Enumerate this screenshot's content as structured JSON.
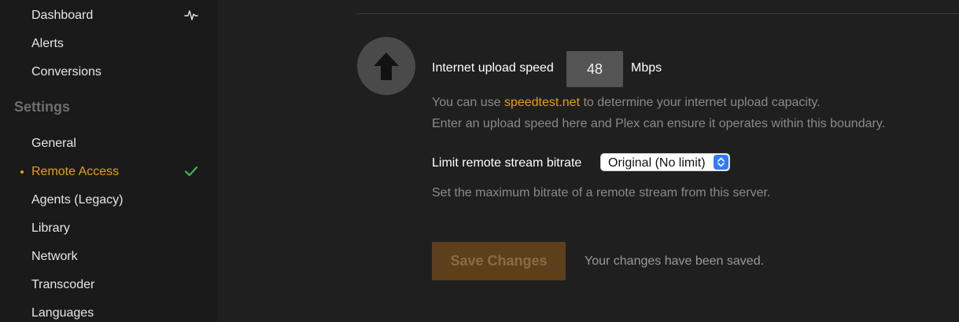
{
  "sidebar": {
    "items_top": [
      {
        "label": "Dashboard",
        "icon": "activity-icon"
      },
      {
        "label": "Alerts"
      },
      {
        "label": "Conversions"
      }
    ],
    "settings_heading": "Settings",
    "items_settings": [
      {
        "label": "General"
      },
      {
        "label": "Remote Access",
        "active": true,
        "icon": "checkmark-icon"
      },
      {
        "label": "Agents (Legacy)"
      },
      {
        "label": "Library"
      },
      {
        "label": "Network"
      },
      {
        "label": "Transcoder"
      },
      {
        "label": "Languages"
      }
    ]
  },
  "upload": {
    "icon": "upload-arrow-icon",
    "label": "Internet upload speed",
    "value": "48",
    "unit": "Mbps",
    "help_prefix": "You can use ",
    "help_link": "speedtest.net",
    "help_suffix": " to determine your internet upload capacity.",
    "help_line2": "Enter an upload speed here and Plex can ensure it operates within this boundary."
  },
  "bitrate": {
    "label": "Limit remote stream bitrate",
    "selected": "Original (No limit)",
    "help": "Set the maximum bitrate of a remote stream from this server."
  },
  "actions": {
    "save_label": "Save Changes",
    "status": "Your changes have been saved."
  },
  "colors": {
    "accent": "#e5a00d",
    "success": "#4caf50",
    "select_accent": "#2f7cf6"
  }
}
